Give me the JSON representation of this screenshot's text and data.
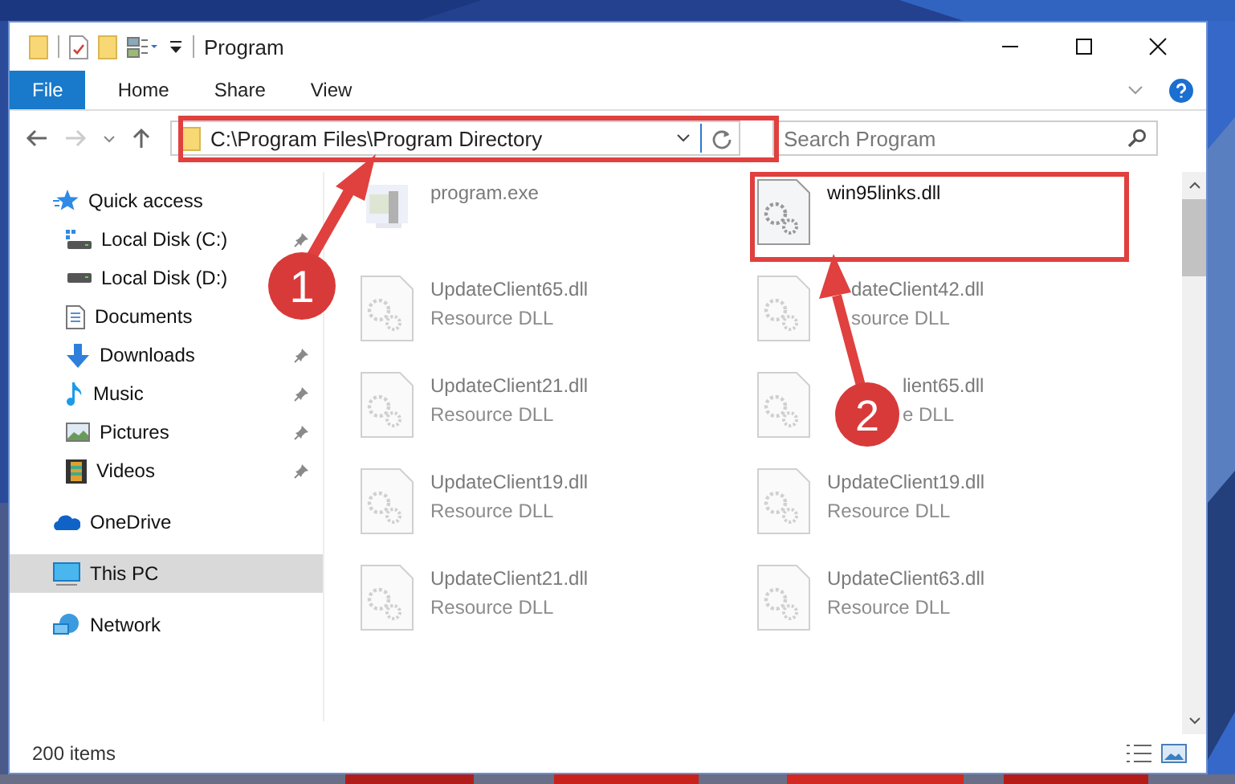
{
  "window": {
    "title": "Program"
  },
  "ribbon": {
    "tabs": [
      {
        "label": "File",
        "selected": true
      },
      {
        "label": "Home",
        "selected": false
      },
      {
        "label": "Share",
        "selected": false
      },
      {
        "label": "View",
        "selected": false
      }
    ]
  },
  "address": {
    "path": "C:\\Program Files\\Program Directory"
  },
  "search": {
    "placeholder": "Search Program"
  },
  "sidebar": {
    "items": [
      {
        "label": "Quick access",
        "kind": "star",
        "selected": false,
        "children": [
          {
            "label": "Local Disk (C:)",
            "kind": "disk-c",
            "pinned": true,
            "selected": false
          },
          {
            "label": "Local Disk (D:)",
            "kind": "disk",
            "pinned": false,
            "selected": false
          },
          {
            "label": "Documents",
            "kind": "doc",
            "pinned": false,
            "selected": false
          },
          {
            "label": "Downloads",
            "kind": "download",
            "pinned": true,
            "selected": false
          },
          {
            "label": "Music",
            "kind": "music",
            "pinned": true,
            "selected": false
          },
          {
            "label": "Pictures",
            "kind": "pictures",
            "pinned": true,
            "selected": false
          },
          {
            "label": "Videos",
            "kind": "videos",
            "pinned": true,
            "selected": false
          }
        ]
      },
      {
        "label": "OneDrive",
        "kind": "cloud",
        "selected": false
      },
      {
        "label": "This PC",
        "kind": "pc",
        "selected": true
      },
      {
        "label": "Network",
        "kind": "network",
        "selected": false
      }
    ]
  },
  "files": [
    {
      "name": "program.exe",
      "kind": "exe",
      "faded": true
    },
    {
      "name": "win95links.dll",
      "kind": "dll",
      "faded": false,
      "highlighted": true
    },
    {
      "name": "UpdateClient65.dll",
      "type": "Resource DLL",
      "kind": "dll",
      "faded": true
    },
    {
      "name": "dateClient42.dll",
      "type": "source DLL",
      "kind": "dll",
      "faded": true
    },
    {
      "name": "UpdateClient21.dll",
      "type": "Resource DLL",
      "kind": "dll",
      "faded": true
    },
    {
      "name": "lient65.dll",
      "type": "e DLL",
      "kind": "dll",
      "faded": true
    },
    {
      "name": "UpdateClient19.dll",
      "type": "Resource DLL",
      "kind": "dll",
      "faded": true
    },
    {
      "name": "UpdateClient19.dll",
      "type": "Resource DLL",
      "kind": "dll",
      "faded": true
    },
    {
      "name": "UpdateClient21.dll",
      "type": "Resource DLL",
      "kind": "dll",
      "faded": true
    },
    {
      "name": "UpdateClient63.dll",
      "type": "Resource DLL",
      "kind": "dll",
      "faded": true
    }
  ],
  "status_bar": {
    "count": "200 items"
  },
  "annotations": [
    {
      "number": "1"
    },
    {
      "number": "2"
    }
  ]
}
